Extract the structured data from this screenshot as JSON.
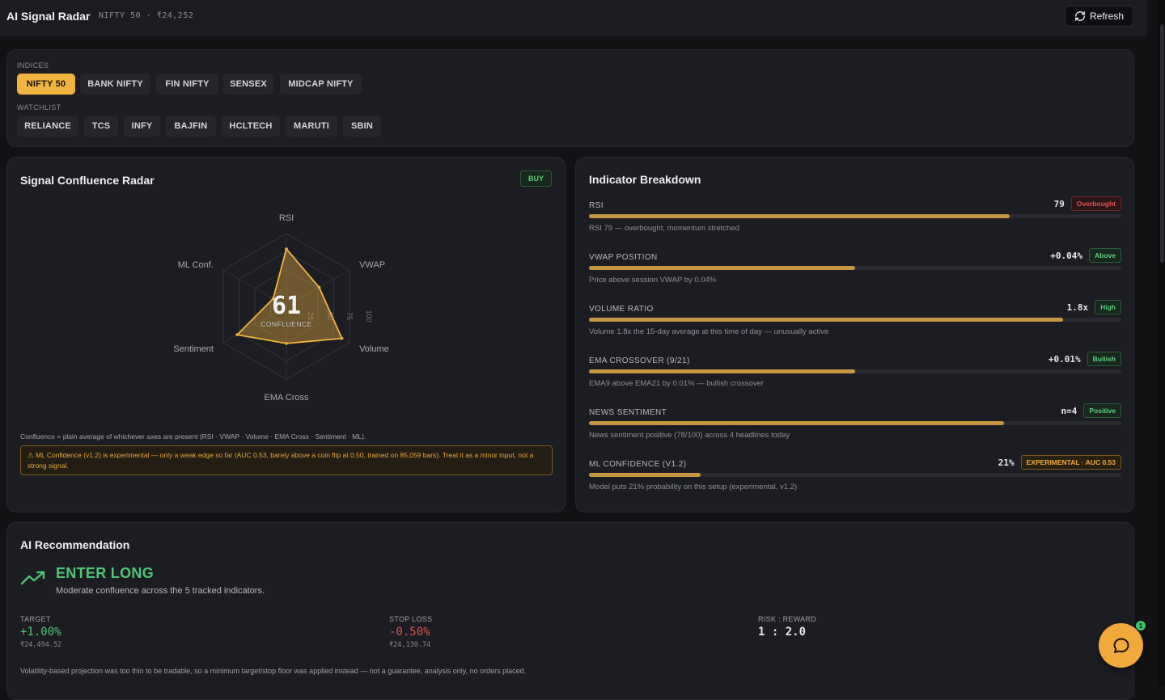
{
  "header": {
    "title": "AI Signal Radar",
    "subtitle": "NIFTY 50 · ₹24,252",
    "refresh_label": "Refresh"
  },
  "selector": {
    "indices_label": "INDICES",
    "indices": [
      "NIFTY 50",
      "BANK NIFTY",
      "FIN NIFTY",
      "SENSEX",
      "MIDCAP NIFTY"
    ],
    "active_index": "NIFTY 50",
    "watchlist_label": "WATCHLIST",
    "watchlist": [
      "RELIANCE",
      "TCS",
      "INFY",
      "BAJFIN",
      "HCLTECH",
      "MARUTI",
      "SBIN"
    ]
  },
  "radar": {
    "title": "Signal Confluence Radar",
    "badge": "BUY",
    "score": "61",
    "score_label": "CONFLUENCE",
    "axes": [
      "RSI",
      "VWAP",
      "Volume",
      "EMA Cross",
      "Sentiment",
      "ML Conf."
    ],
    "values": [
      79,
      52,
      88,
      51,
      78,
      21
    ],
    "rings": [
      "25",
      "50",
      "75",
      "100"
    ],
    "footnote": "Confluence = plain average of whichever axes are present (RSI · VWAP · Volume · EMA Cross · Sentiment · ML).",
    "warning": "⚠ ML Confidence (v1.2) is experimental — only a weak edge so far (AUC 0.53, barely above a coin flip at 0.50, trained on 85,059 bars). Treat it as a minor input, not a strong signal."
  },
  "breakdown": {
    "title": "Indicator Breakdown",
    "items": [
      {
        "label": "RSI",
        "value": "79",
        "badge": "Overbought",
        "tone": "red",
        "fill": 79,
        "desc": "RSI 79 — overbought, momentum stretched"
      },
      {
        "label": "VWAP POSITION",
        "value": "+0.04%",
        "badge": "Above",
        "tone": "green",
        "fill": 50,
        "desc": "Price above session VWAP by 0.04%"
      },
      {
        "label": "VOLUME RATIO",
        "value": "1.8x",
        "badge": "High",
        "tone": "green",
        "fill": 89,
        "desc": "Volume 1.8x the 15-day average at this time of day — unusually active"
      },
      {
        "label": "EMA CROSSOVER (9/21)",
        "value": "+0.01%",
        "badge": "Bullish",
        "tone": "green",
        "fill": 50,
        "desc": "EMA9 above EMA21 by 0.01% — bullish crossover"
      },
      {
        "label": "NEWS SENTIMENT",
        "value": "n=4",
        "badge": "Positive",
        "tone": "green",
        "fill": 78,
        "desc": "News sentiment positive (78/100) across 4 headlines today"
      },
      {
        "label": "ML CONFIDENCE (V1.2)",
        "value": "21%",
        "badge": "EXPERIMENTAL · AUC 0.53",
        "tone": "amber",
        "fill": 21,
        "desc": "Model puts 21% probability on this setup (experimental, v1.2)"
      }
    ]
  },
  "recommendation": {
    "title": "AI Recommendation",
    "action": "ENTER LONG",
    "summary": "Moderate confluence across the 5 tracked indicators.",
    "target_label": "TARGET",
    "target_value": "+1.00%",
    "target_price": "₹24,494.52",
    "stop_label": "STOP LOSS",
    "stop_value": "-0.50%",
    "stop_price": "₹24,130.74",
    "rr_label": "RISK : REWARD",
    "rr_value": "1 : 2.0",
    "disclaimer": "Volatility-based projection was too thin to be tradable, so a minimum target/stop floor was applied instead — not a guarantee, analysis only, no orders placed.",
    "colors": {
      "positive": "#4fc474",
      "negative": "#e0534f"
    }
  },
  "chat": {
    "badge_count": "1"
  }
}
